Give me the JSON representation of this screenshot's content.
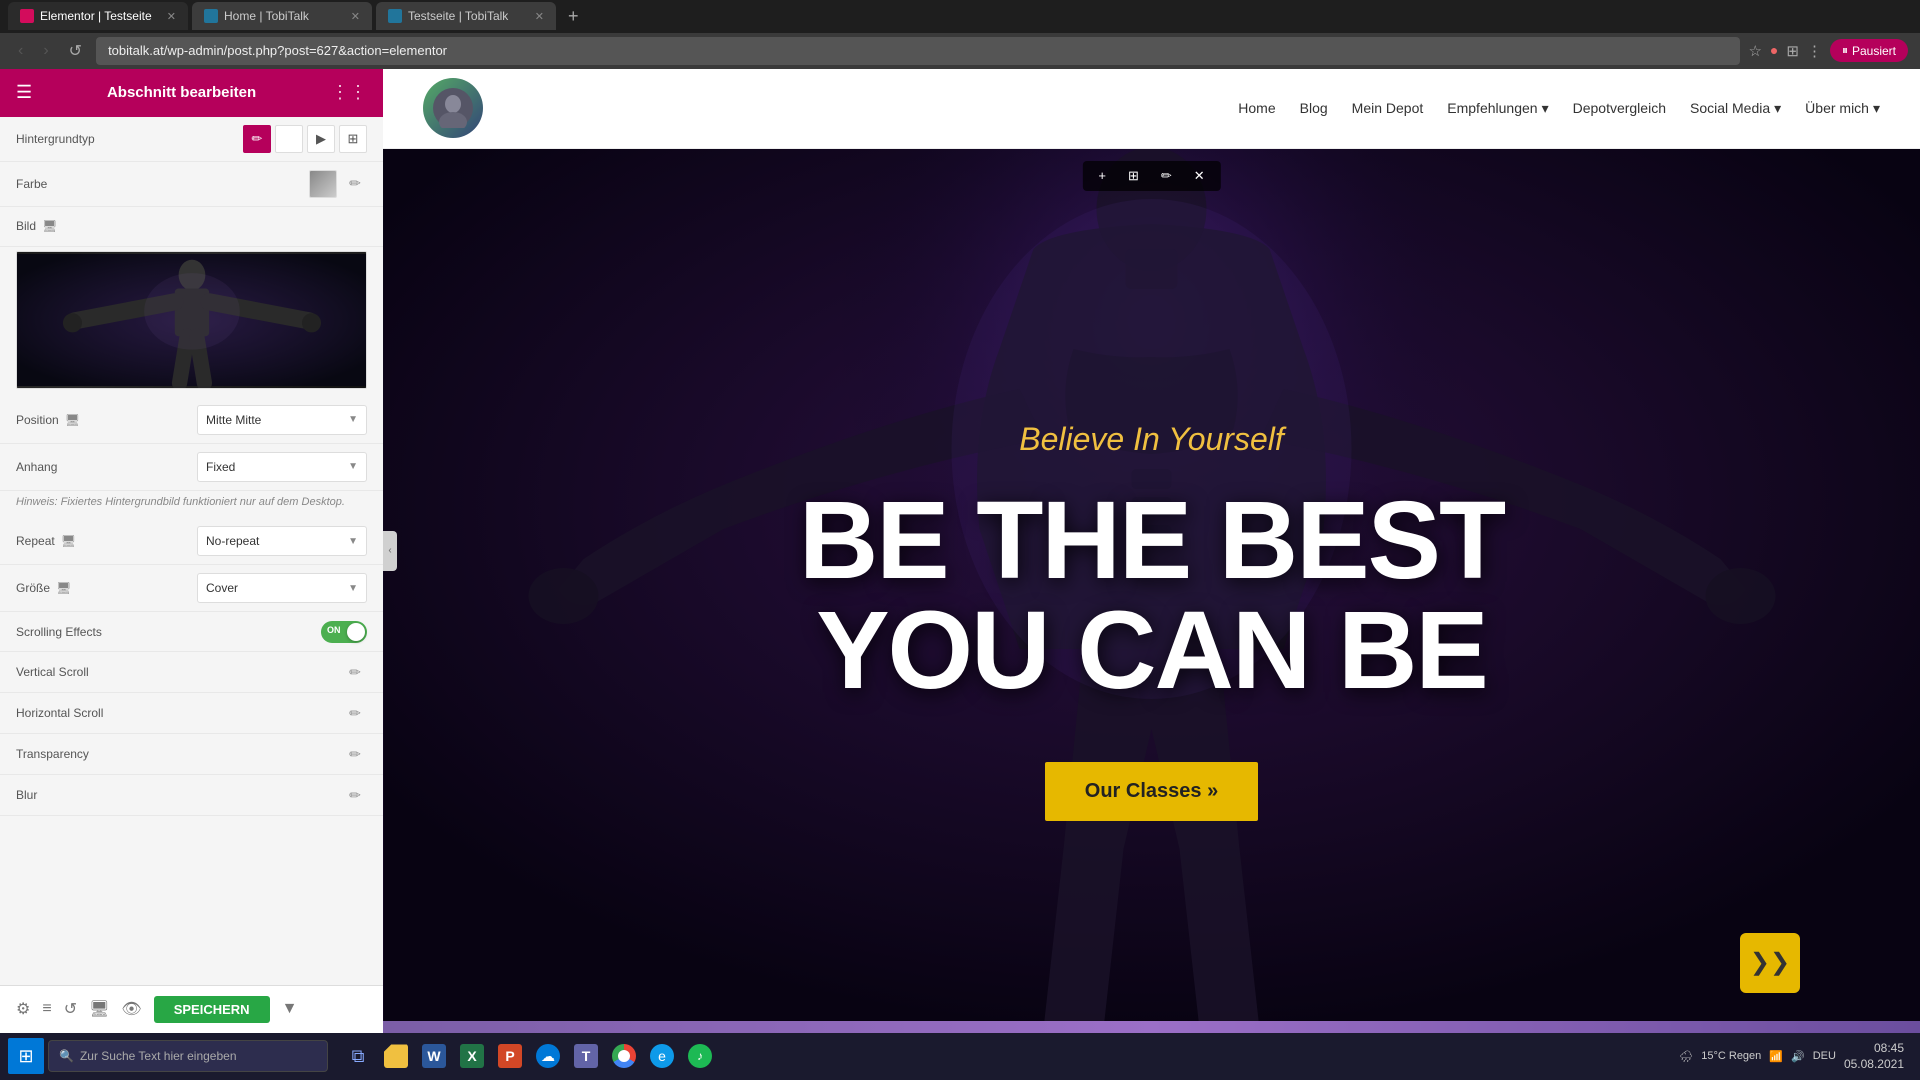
{
  "browser": {
    "tabs": [
      {
        "id": "tab1",
        "title": "Elementor | Testseite",
        "icon": "elementor",
        "active": true
      },
      {
        "id": "tab2",
        "title": "Home | TobiTalk",
        "icon": "wordpress",
        "active": false
      },
      {
        "id": "tab3",
        "title": "Testseite | TobiTalk",
        "icon": "wordpress",
        "active": false
      }
    ],
    "url": "tobitalk.at/wp-admin/post.php?post=627&action=elementor",
    "nav": {
      "back": "‹",
      "forward": "›",
      "reload": "↺",
      "home": "⌂"
    }
  },
  "panel": {
    "title": "Abschnitt bearbeiten",
    "sections": {
      "hintergrundtyp": {
        "label": "Hintergrundtyp"
      },
      "farbe": {
        "label": "Farbe"
      },
      "bild": {
        "label": "Bild"
      },
      "position": {
        "label": "Position",
        "value": "Mitte Mitte"
      },
      "anhang": {
        "label": "Anhang",
        "value": "Fixed"
      },
      "hint": "Hinweis: Fixiertes Hintergrundbild funktioniert nur auf dem Desktop.",
      "repeat": {
        "label": "Repeat",
        "value": "No-repeat"
      },
      "groesse": {
        "label": "Größe",
        "value": "Cover"
      },
      "scrolling_effects": {
        "label": "Scrolling Effects",
        "toggle": "ON"
      },
      "vertical_scroll": {
        "label": "Vertical Scroll"
      },
      "horizontal_scroll": {
        "label": "Horizontal Scroll"
      },
      "transparency": {
        "label": "Transparency"
      },
      "blur": {
        "label": "Blur"
      }
    },
    "footer": {
      "save_label": "SPEICHERN"
    }
  },
  "website": {
    "nav": {
      "links": [
        "Home",
        "Blog",
        "Mein Depot",
        "Empfehlungen",
        "Depotvergleich",
        "Social Media",
        "Über mich"
      ]
    },
    "hero": {
      "subtitle": "Believe In Yourself",
      "title_line1": "BE THE BEST",
      "title_line2": "YOU CAN BE",
      "cta": "Our Classes »"
    }
  },
  "taskbar": {
    "search_placeholder": "Zur Suche Text hier eingeben",
    "clock": "08:45",
    "date": "05.08.2021",
    "weather": "15°C Regen",
    "lang": "DEU"
  }
}
